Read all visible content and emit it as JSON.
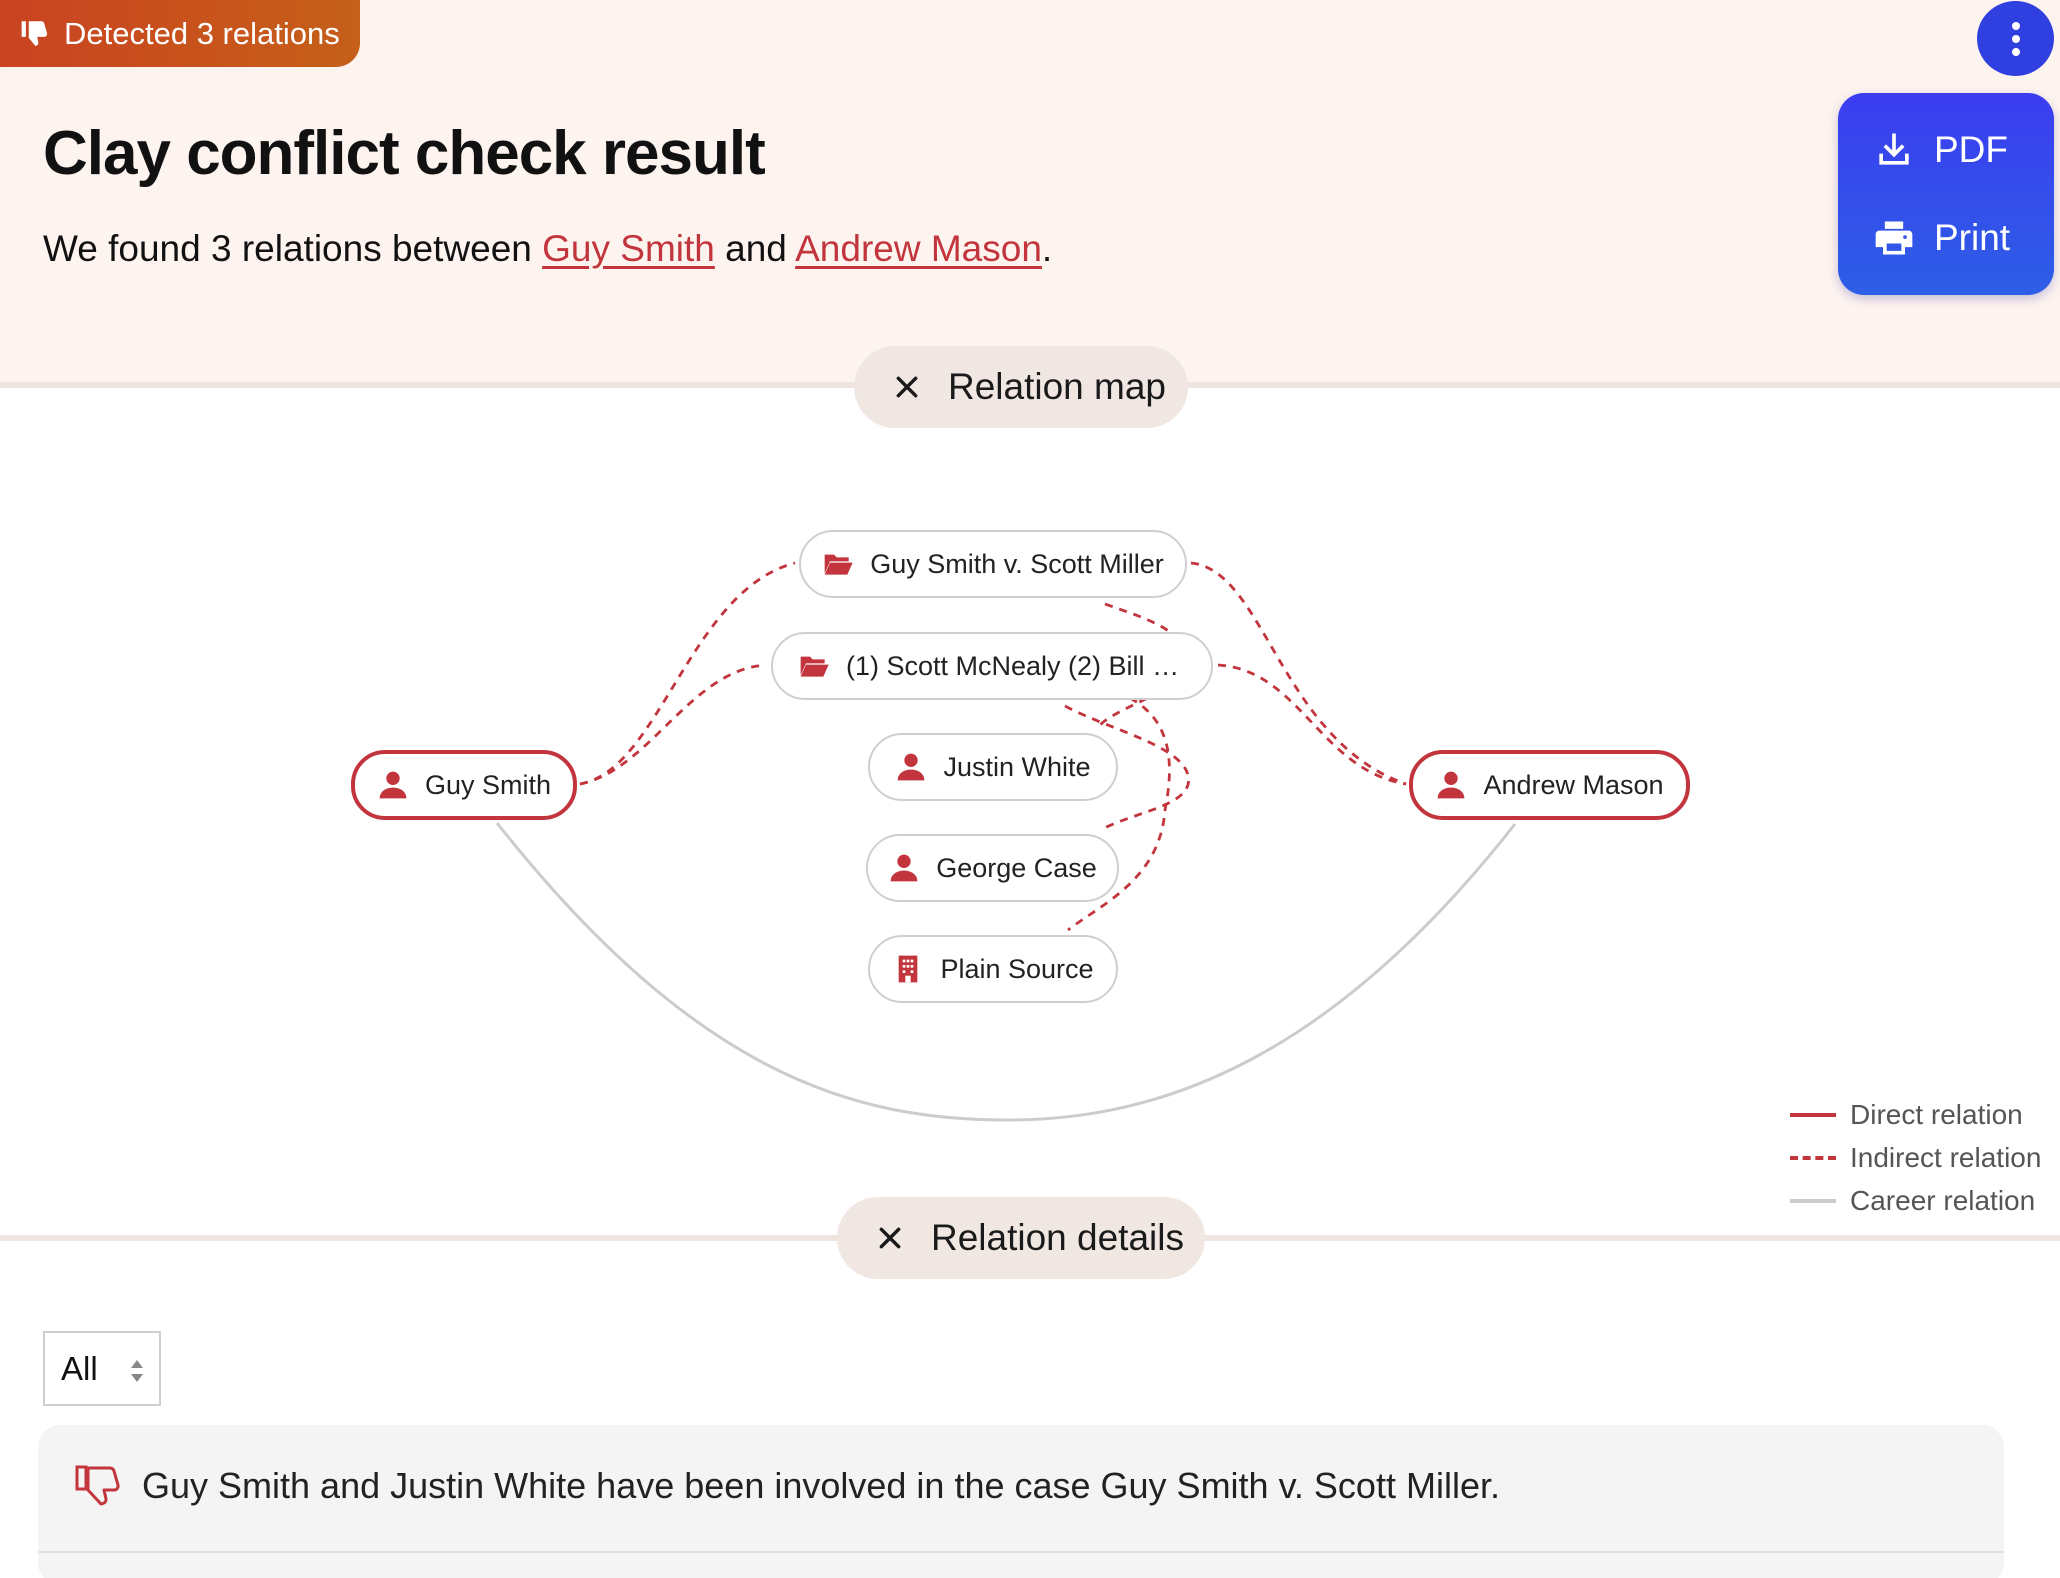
{
  "header": {
    "badge_text": "Detected 3 relations",
    "badge_icon": "thumbs-down-icon",
    "title": "Clay conflict check result",
    "summary_prefix": "We found 3 relations between ",
    "party_a": "Guy Smith",
    "summary_mid": " and ",
    "party_b": "Andrew Mason",
    "summary_suffix": "."
  },
  "actions": {
    "menu_icon": "more-vertical-icon",
    "pdf_label": "PDF",
    "print_label": "Print"
  },
  "relation_map": {
    "section_label": "Relation map",
    "nodes": {
      "party_a": "Guy Smith",
      "party_b": "Andrew Mason",
      "case_1": "Guy Smith v. Scott Miller",
      "case_2": "(1) Scott McNealy (2) Bill Joy",
      "person_1": "Justin White",
      "person_2": "George Case",
      "org_1": "Plain Source"
    },
    "legend": {
      "direct": "Direct relation",
      "indirect": "Indirect relation",
      "career": "Career relation"
    }
  },
  "relation_details": {
    "section_label": "Relation details",
    "filter_value": "All",
    "items": [
      {
        "text": "Guy Smith and Justin White have been involved in the case Guy Smith v. Scott Miller."
      }
    ]
  },
  "colors": {
    "accent_red": "#c2353d",
    "badge_orange": "#c8541b",
    "action_blue": "#2f3fe0",
    "header_bg": "#fdf3ef",
    "pill_bg": "#f0e7e2"
  }
}
